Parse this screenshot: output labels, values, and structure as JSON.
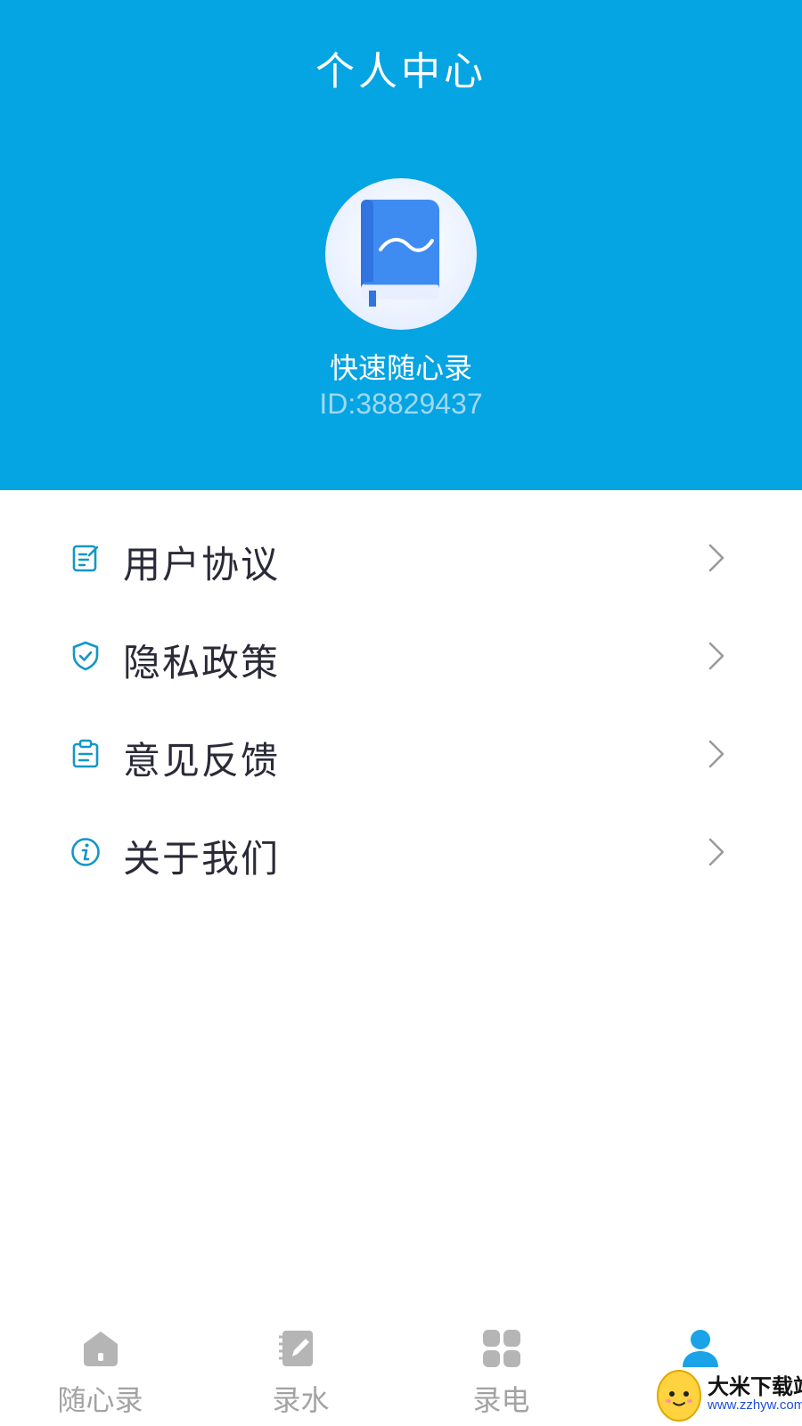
{
  "header": {
    "title": "个人中心",
    "app_name": "快速随心录",
    "user_id": "ID:38829437",
    "avatar_icon": "book-icon",
    "background_color": "#05a4e3"
  },
  "menu": {
    "items": [
      {
        "label": "用户协议",
        "icon": "edit-document-icon"
      },
      {
        "label": "隐私政策",
        "icon": "shield-check-icon"
      },
      {
        "label": "意见反馈",
        "icon": "clipboard-icon"
      },
      {
        "label": "关于我们",
        "icon": "info-icon"
      }
    ],
    "icon_color": "#1296c9",
    "chevron_icon": "chevron-right-icon"
  },
  "tabbar": {
    "tabs": [
      {
        "label": "随心录",
        "icon": "home-icon",
        "active": false
      },
      {
        "label": "录水",
        "icon": "notebook-pen-icon",
        "active": false
      },
      {
        "label": "录电",
        "icon": "grid-icon",
        "active": false
      },
      {
        "label": "",
        "icon": "user-icon",
        "active": true
      }
    ],
    "active_color": "#1aa3e6",
    "inactive_color": "#a3a3a3"
  },
  "watermark": {
    "title": "大米下载站",
    "url": "www.zzhyw.com"
  }
}
